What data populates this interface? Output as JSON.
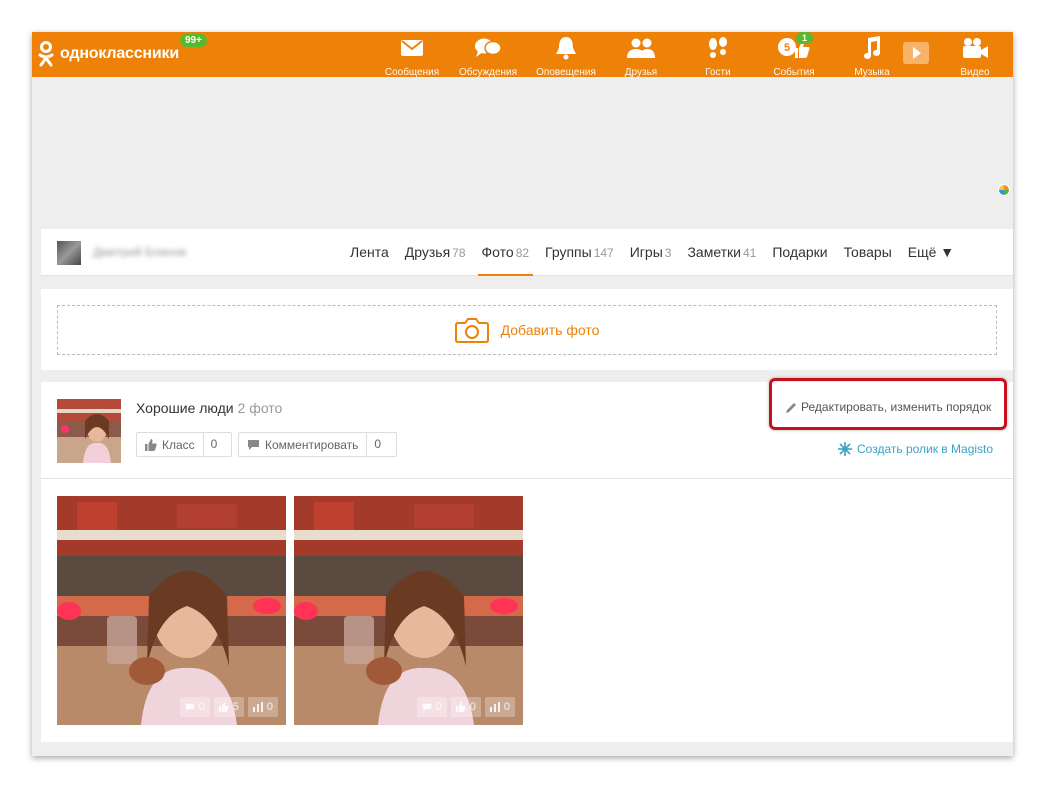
{
  "topbar": {
    "logo_text": "одноклассники",
    "logo_badge": "99+",
    "nav": [
      {
        "label": "Сообщения",
        "icon": "envelope-icon"
      },
      {
        "label": "Обсуждения",
        "icon": "chat-bubbles-icon"
      },
      {
        "label": "Оповещения",
        "icon": "bell-icon"
      },
      {
        "label": "Друзья",
        "icon": "friends-icon"
      },
      {
        "label": "Гости",
        "icon": "footprints-icon"
      },
      {
        "label": "События",
        "icon": "thumbs-up-icon",
        "badge": "1",
        "count": "5"
      },
      {
        "label": "Музыка",
        "icon": "music-note-icon"
      },
      {
        "label": "Видео",
        "icon": "video-camera-icon"
      }
    ]
  },
  "profile": {
    "name": "Дмитрий Блинов",
    "tabs": [
      {
        "label": "Лента",
        "count": ""
      },
      {
        "label": "Друзья",
        "count": "78"
      },
      {
        "label": "Фото",
        "count": "82"
      },
      {
        "label": "Группы",
        "count": "147"
      },
      {
        "label": "Игры",
        "count": "3"
      },
      {
        "label": "Заметки",
        "count": "41"
      },
      {
        "label": "Подарки",
        "count": ""
      },
      {
        "label": "Товары",
        "count": ""
      },
      {
        "label": "Ещё ▼",
        "count": ""
      }
    ],
    "active_tab": "Фото"
  },
  "add_photo": {
    "label": "Добавить фото"
  },
  "album": {
    "title": "Хорошие люди",
    "count": "2 фото",
    "like_label": "Класс",
    "like_count": "0",
    "comment_label": "Комментировать",
    "comment_count": "0",
    "edit_label": "Редактировать, изменить порядок",
    "magisto_label": "Создать ролик в Magisto",
    "photos": [
      {
        "comments": "0",
        "likes": "5",
        "views": "0"
      },
      {
        "comments": "0",
        "likes": "0",
        "views": "0"
      }
    ]
  },
  "colors": {
    "brand": "#ee8208",
    "badge": "#5ab82e",
    "highlight": "#c8101a",
    "link": "#3aa4c6"
  }
}
